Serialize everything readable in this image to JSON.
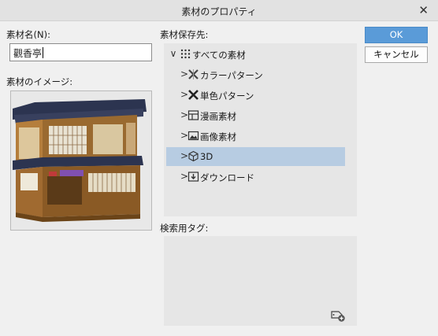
{
  "window": {
    "title": "素材のプロパティ",
    "close_glyph": "✕"
  },
  "form": {
    "name_label": "素材名(N):",
    "name_value": "觀香亭",
    "image_label": "素材のイメージ:",
    "location_label": "素材保存先:",
    "tag_label": "検索用タグ:"
  },
  "tree": {
    "root": {
      "label": "すべての素材",
      "chevron": "∨",
      "icon": "dots-grid-icon"
    },
    "items": [
      {
        "label": "カラーパターン",
        "chevron": ">",
        "icon": "color-pattern-icon",
        "selected": false
      },
      {
        "label": "単色パターン",
        "chevron": ">",
        "icon": "mono-pattern-icon",
        "selected": false
      },
      {
        "label": "漫画素材",
        "chevron": ">",
        "icon": "manga-icon",
        "selected": false
      },
      {
        "label": "画像素材",
        "chevron": ">",
        "icon": "image-icon",
        "selected": false
      },
      {
        "label": "3D",
        "chevron": ">",
        "icon": "cube-icon",
        "selected": true
      },
      {
        "label": "ダウンロード",
        "chevron": ">",
        "icon": "download-icon",
        "selected": false
      }
    ]
  },
  "buttons": {
    "ok": "OK",
    "cancel": "キャンセル"
  },
  "tags": {
    "add_icon": "add-tag-icon"
  },
  "colors": {
    "selection": "#b7cce2",
    "ok_button": "#5a9bd8",
    "panel": "#e6e6e6"
  }
}
